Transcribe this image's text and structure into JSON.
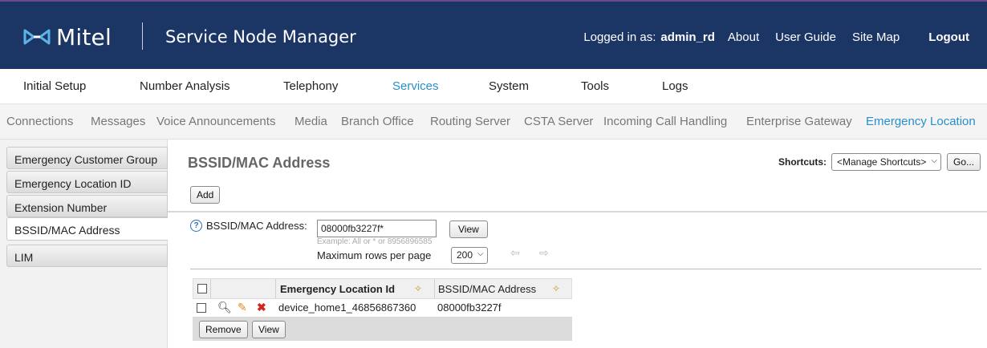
{
  "header": {
    "logo_text": "Mitel",
    "product_title": "Service Node Manager",
    "logged_in_label": "Logged in as:",
    "username": "admin_rd",
    "links": [
      "About",
      "User Guide",
      "Site Map"
    ],
    "logout": "Logout"
  },
  "main_nav": {
    "items": [
      "Initial Setup",
      "Number Analysis",
      "Telephony",
      "Services",
      "System",
      "Tools",
      "Logs"
    ],
    "active": "Services"
  },
  "sub_nav": {
    "items": [
      "Connections",
      "Messages",
      "Voice Announcements",
      "Media",
      "Branch Office",
      "Routing Server",
      "CSTA Server",
      "Incoming Call Handling",
      "Enterprise Gateway",
      "Emergency Location"
    ],
    "active": "Emergency Location"
  },
  "sidebar": {
    "items": [
      "Emergency Customer Group",
      "Emergency Location ID",
      "Extension Number",
      "BSSID/MAC Address",
      "LIM"
    ],
    "active": "BSSID/MAC Address"
  },
  "page": {
    "title": "BSSID/MAC Address",
    "shortcuts_label": "Shortcuts:",
    "shortcuts_value": "<Manage Shortcuts>",
    "go_label": "Go...",
    "add_label": "Add"
  },
  "filter": {
    "label": "BSSID/MAC Address:",
    "value": "08000fb3227f*",
    "example": "Example: All or * or 8956896585",
    "view_label": "View",
    "max_rows_label": "Maximum rows per page",
    "max_rows_value": "200"
  },
  "table": {
    "columns": [
      "Emergency Location Id",
      "BSSID/MAC Address"
    ],
    "rows": [
      {
        "emergency_location_id": "device_home1_46856867360",
        "bssid_mac": "08000fb3227f"
      }
    ],
    "remove_label": "Remove",
    "view_label": "View"
  },
  "colors": {
    "header_bg": "#1b3564",
    "accent": "#2a8fc7",
    "delete_red": "#d6231e",
    "edit_orange": "#e08a1e"
  },
  "icons": [
    "mitel-logo-icon",
    "help-icon",
    "sort-icon",
    "search-icon",
    "edit-icon",
    "delete-icon",
    "arrow-left-icon",
    "arrow-right-icon",
    "chevron-down-icon"
  ]
}
